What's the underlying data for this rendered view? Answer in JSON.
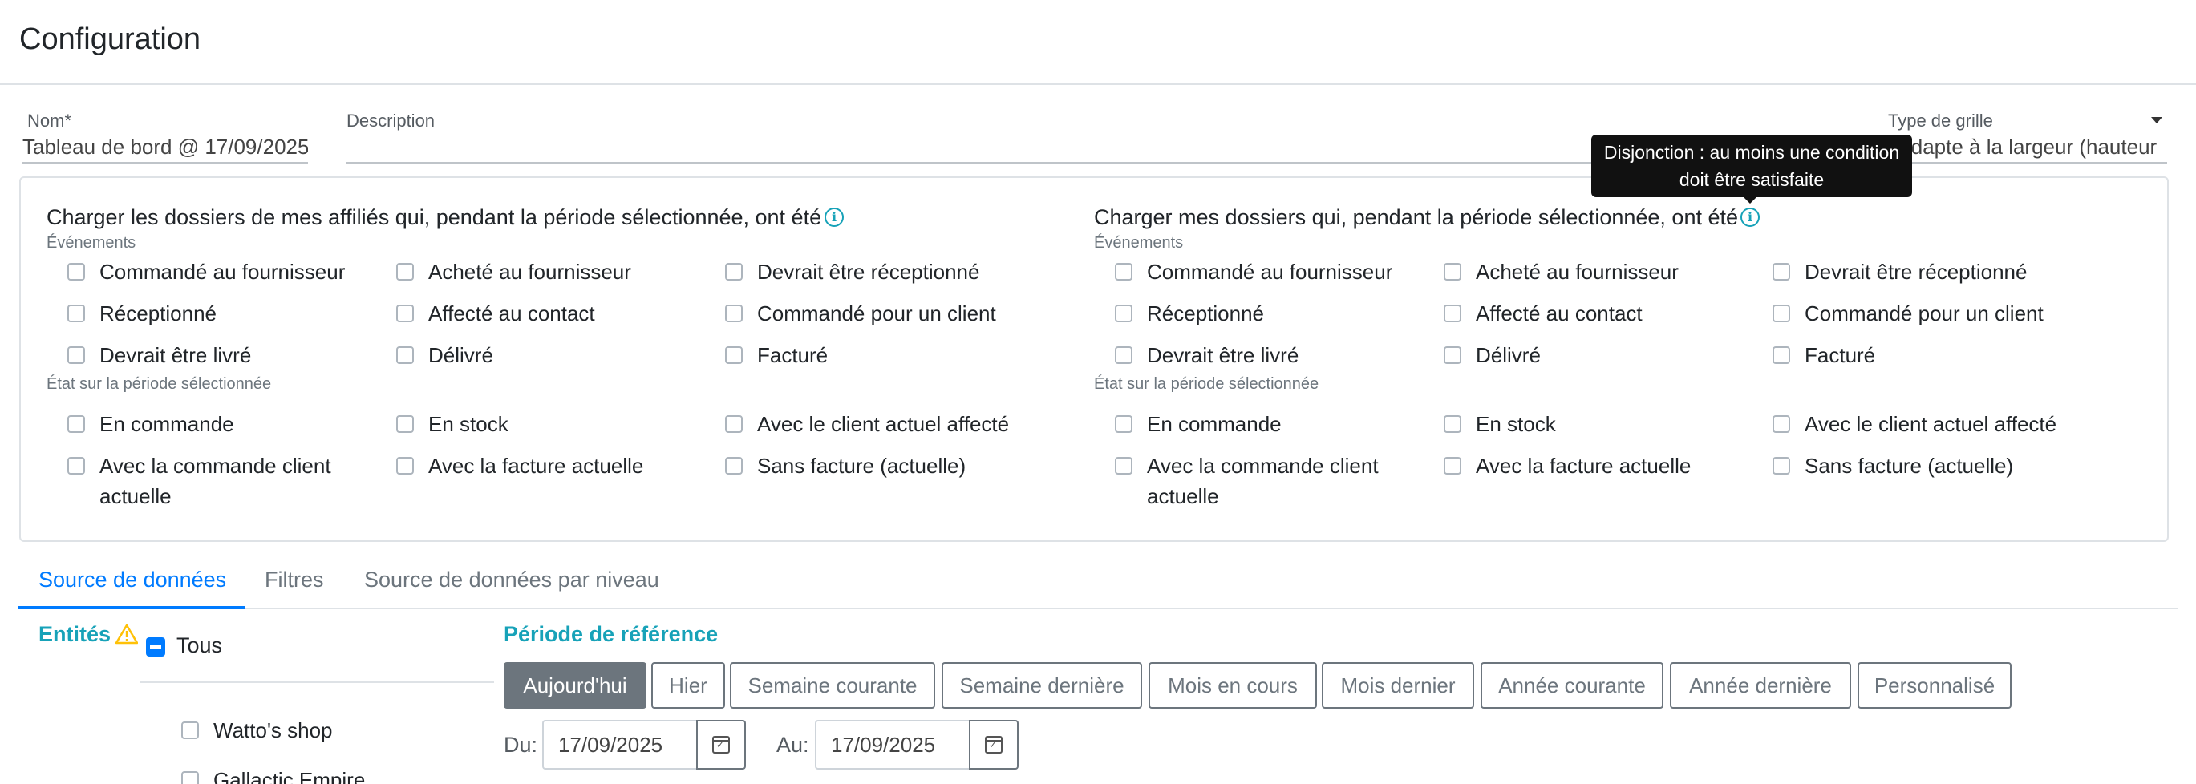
{
  "header": {
    "title": "Configuration"
  },
  "form": {
    "name_label": "Nom*",
    "name_value": "Tableau de bord @ 17/09/2025",
    "description_label": "Description",
    "description_value": "",
    "grid_type_label": "Type de grille",
    "grid_type_value": "S'adapte à la largeur (hauteur"
  },
  "tooltip": {
    "text": "Disjonction : au moins une condition doit être satisfaite"
  },
  "groups": {
    "left": {
      "title": "Charger les dossiers de mes affiliés qui, pendant la période sélectionnée, ont été",
      "events_label": "Événements",
      "state_label": "État sur la période sélectionnée"
    },
    "right": {
      "title": "Charger mes dossiers qui, pendant la période sélectionnée, ont été",
      "events_label": "Événements",
      "state_label": "État sur la période sélectionnée"
    }
  },
  "options": {
    "events": [
      "Commandé au fournisseur",
      "Acheté au fournisseur",
      "Devrait être réceptionné",
      "Réceptionné",
      "Affecté au contact",
      "Commandé pour un client",
      "Devrait être livré",
      "Délivré",
      "Facturé"
    ],
    "states": [
      "En commande",
      "En stock",
      "Avec le client actuel affecté",
      "Avec la commande client actuelle",
      "Avec la facture actuelle",
      "Sans facture (actuelle)"
    ]
  },
  "tabs": [
    {
      "label": "Source de données",
      "active": true
    },
    {
      "label": "Filtres",
      "active": false
    },
    {
      "label": "Source de données par niveau",
      "active": false
    }
  ],
  "entities": {
    "label": "Entités",
    "all_label": "Tous",
    "items": [
      "Watto's shop",
      "Gallactic Empire"
    ]
  },
  "period": {
    "label": "Période de référence",
    "buttons": [
      {
        "label": "Aujourd'hui",
        "active": true
      },
      {
        "label": "Hier",
        "active": false
      },
      {
        "label": "Semaine courante",
        "active": false
      },
      {
        "label": "Semaine dernière",
        "active": false
      },
      {
        "label": "Mois en cours",
        "active": false
      },
      {
        "label": "Mois dernier",
        "active": false
      },
      {
        "label": "Année courante",
        "active": false
      },
      {
        "label": "Année dernière",
        "active": false
      },
      {
        "label": "Personnalisé",
        "active": false
      }
    ],
    "from_label": "Du:",
    "from_value": "17/09/2025",
    "to_label": "Au:",
    "to_value": "17/09/2025"
  },
  "colors": {
    "accent": "#007bff",
    "info": "#17a2b8",
    "warning": "#ffc107",
    "secondary": "#6c757d"
  }
}
